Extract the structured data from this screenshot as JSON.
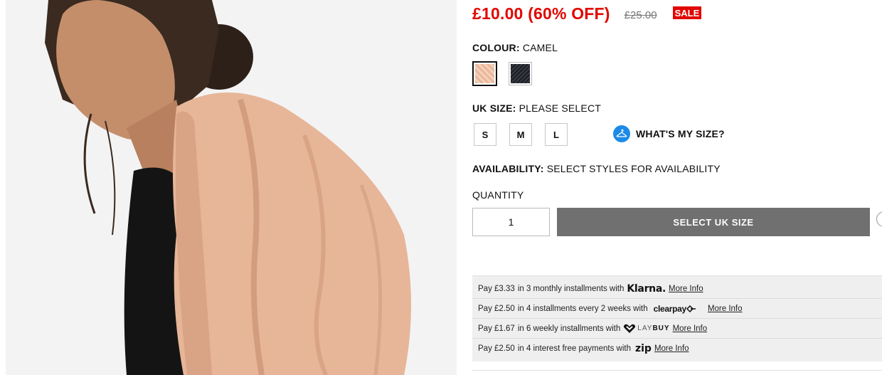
{
  "price": {
    "current": "£10.00 (60% OFF)",
    "was": "£25.00",
    "badge": "SALE"
  },
  "colour": {
    "label": "COLOUR:",
    "value": "CAMEL",
    "swatches": [
      {
        "name": "camel",
        "color": "#e9b89a",
        "selected": true
      },
      {
        "name": "black",
        "color": "#1b1c22",
        "selected": false
      }
    ]
  },
  "size": {
    "label": "UK SIZE:",
    "value": "PLEASE SELECT",
    "options": [
      "S",
      "M",
      "L"
    ],
    "guide": "WHAT'S MY SIZE?"
  },
  "availability": {
    "label": "AVAILABILITY:",
    "value": "SELECT STYLES FOR AVAILABILITY"
  },
  "quantity": {
    "label": "QUANTITY",
    "value": "1"
  },
  "add_button": "SELECT UK SIZE",
  "payments": [
    {
      "prefix": "Pay",
      "amount": "£3.33",
      "text": "in 3 monthly installments with",
      "brand": "Klarna.",
      "link": "More Info"
    },
    {
      "prefix": "Pay",
      "amount": "£2.50",
      "text": "in 4 installments every 2 weeks with",
      "brand": "clearpay",
      "link": "More Info"
    },
    {
      "prefix": "Pay",
      "amount": "£1.67",
      "text": "in 6 weekly installments with",
      "brand_a": "LAY",
      "brand_b": "BUY",
      "link": "More Info"
    },
    {
      "prefix": "Pay",
      "amount": "£2.50",
      "text": "in 4 interest free payments with",
      "brand": "zip",
      "link": "More Info"
    }
  ],
  "colors": {
    "sale_red": "#e10600",
    "button_grey": "#707070",
    "size_guide_blue": "#1d8ae8"
  }
}
